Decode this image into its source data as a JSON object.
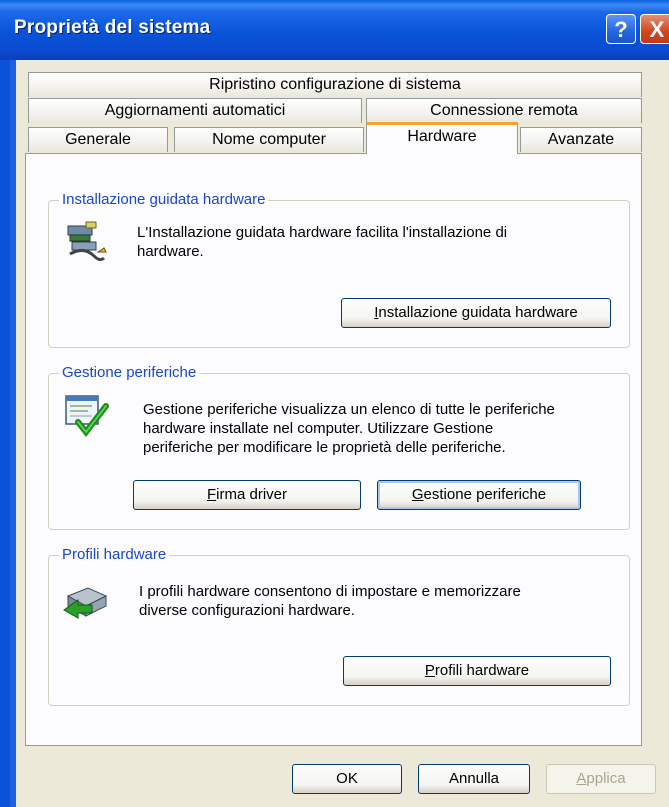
{
  "window": {
    "title": "Proprietà del sistema"
  },
  "title_buttons": {
    "help": "?",
    "close": "X"
  },
  "tabs": [
    {
      "label": "Ripristino configurazione di sistema"
    },
    {
      "label": "Aggiornamenti automatici"
    },
    {
      "label": "Connessione remota"
    },
    {
      "label": "Generale"
    },
    {
      "label": "Nome computer"
    },
    {
      "label": "Hardware",
      "selected": true
    },
    {
      "label": "Avanzate"
    }
  ],
  "groups": {
    "wizard": {
      "title": "Installazione guidata hardware",
      "text_line1": "L'Installazione guidata hardware facilita l'installazione di",
      "text_line2": "hardware.",
      "button": {
        "prefix": "",
        "accel": "I",
        "rest": "nstallazione guidata hardware"
      },
      "icon": "hardware-wizard-icon"
    },
    "devices": {
      "title": "Gestione periferiche",
      "text_line1": "Gestione periferiche visualizza un elenco di tutte le periferiche",
      "text_line2": "hardware installate nel computer. Utilizzare Gestione",
      "text_line3": "periferiche per modificare le proprietà delle periferiche.",
      "button_sign": {
        "accel": "F",
        "rest": "irma driver"
      },
      "button_manager": {
        "accel": "G",
        "rest": "estione periferiche"
      },
      "icon": "device-manager-icon"
    },
    "profiles": {
      "title": "Profili hardware",
      "text_line1": "I profili hardware consentono di impostare e memorizzare",
      "text_line2": "diverse configurazioni hardware.",
      "button": {
        "accel": "P",
        "rest": "rofili hardware"
      },
      "icon": "hardware-profiles-icon"
    }
  },
  "footer": {
    "ok": "OK",
    "cancel": "Annulla",
    "apply": {
      "accel": "A",
      "rest": "pplica"
    }
  }
}
